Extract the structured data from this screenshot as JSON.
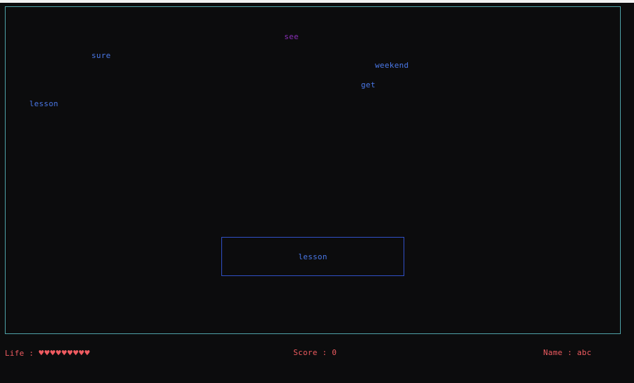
{
  "colors": {
    "background": "#0c0c0d",
    "frame": "#4fa3a8",
    "word": "#4a78e8",
    "special_word": "#8a2fb8",
    "input_border": "#3050c8",
    "status": "#ef5b60"
  },
  "falling_words": [
    {
      "text": "see",
      "style": "special"
    },
    {
      "text": "sure",
      "style": "normal"
    },
    {
      "text": "weekend",
      "style": "normal"
    },
    {
      "text": "get",
      "style": "normal"
    },
    {
      "text": "lesson",
      "style": "normal"
    }
  ],
  "input": {
    "value": "lesson"
  },
  "status": {
    "life_label": "Life : ",
    "hearts": "♥♥♥♥♥♥♥♥♥",
    "lives": 9,
    "score_label": "Score : 0",
    "name_label": "Name : abc"
  }
}
